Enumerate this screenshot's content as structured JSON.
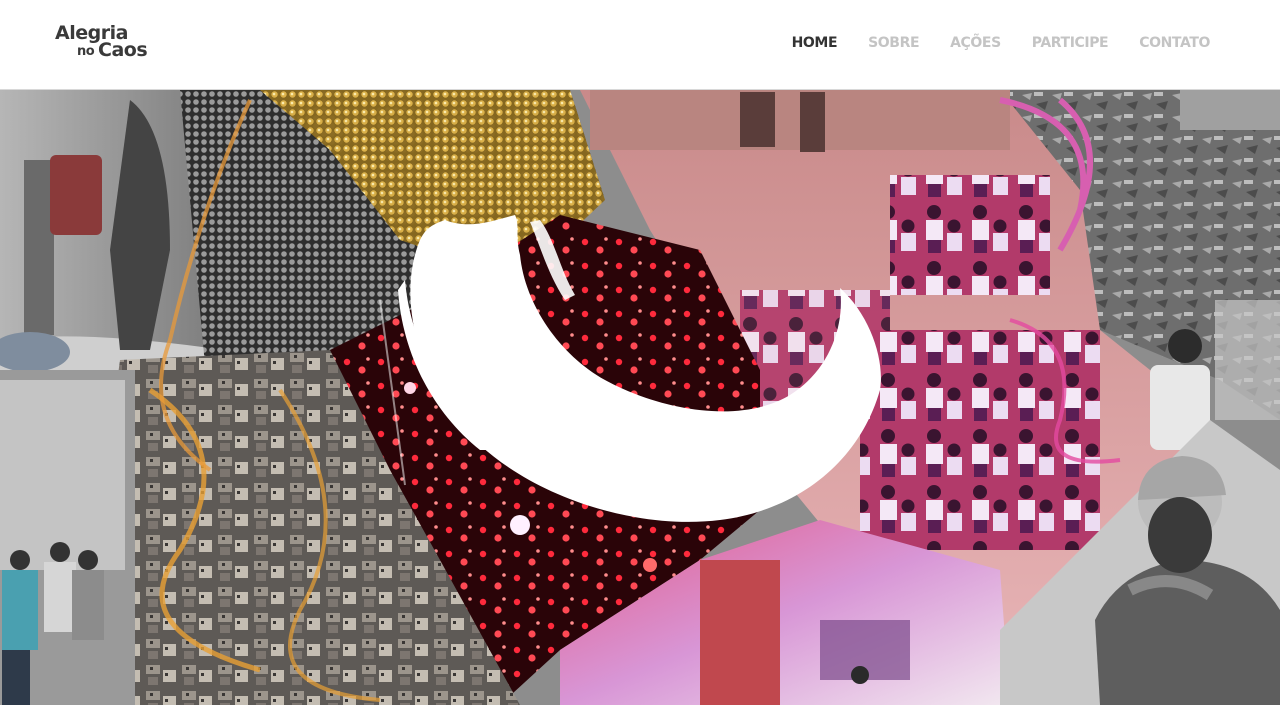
{
  "header": {
    "logo": {
      "line1": "Alegria",
      "line2_small": "no",
      "line2_big": "Caos"
    },
    "nav": [
      {
        "label": "HOME",
        "active": true
      },
      {
        "label": "SOBRE",
        "active": false
      },
      {
        "label": "AÇÕES",
        "active": false
      },
      {
        "label": "PARTICIPE",
        "active": false
      },
      {
        "label": "CONTATO",
        "active": false
      }
    ],
    "colors": {
      "nav_active": "#333333",
      "nav_inactive": "#c4c4c4"
    }
  },
  "hero": {
    "panels": [
      "street-water-pump-photo",
      "crowd-photo",
      "school-children-photo",
      "traffic-lights-photo",
      "favela-photo",
      "debris-photo",
      "man-with-cap-photo",
      "alley-photo"
    ],
    "center_icon": "white-brush-swoosh-icon",
    "colors": {
      "magenta_tint": "#b0308a",
      "gold_tint": "#c99526",
      "red_tint": "#d0203a"
    }
  }
}
